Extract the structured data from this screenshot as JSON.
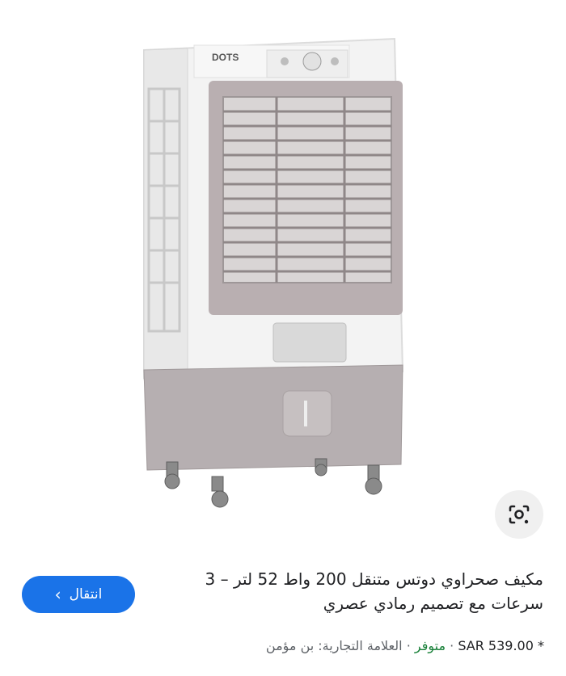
{
  "product": {
    "title": "مكيف صحراوي دوتس متنقل 200 واط 52 لتر – 3 سرعات مع تصميم رمادي عصري",
    "brand_logo": "DOTS",
    "price": "SAR 539.00",
    "price_marker": "*",
    "availability": "متوفر",
    "brand_label": "العلامة التجارية: بن مؤمن",
    "separator": "·"
  },
  "actions": {
    "go_label": "انتقال"
  },
  "icons": {
    "lens": "google-lens-icon",
    "chevron": "chevron-left-icon"
  },
  "colors": {
    "accent": "#1a73e8",
    "stock": "#188038",
    "text": "#202124",
    "muted": "#5f6368"
  }
}
